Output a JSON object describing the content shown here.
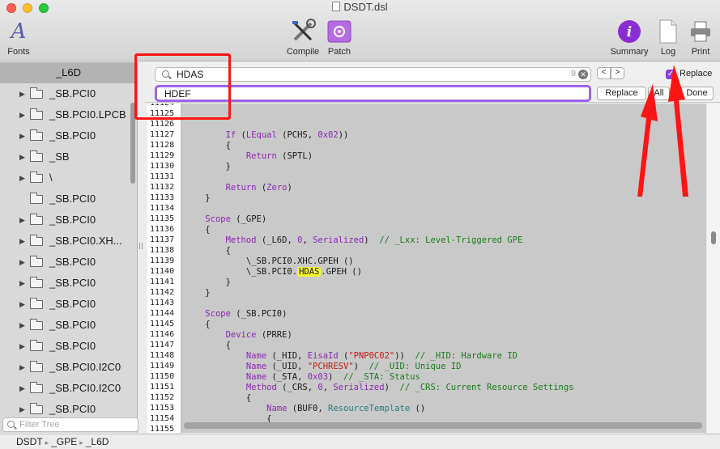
{
  "window": {
    "title": "DSDT.dsl"
  },
  "toolbar": {
    "fonts_label": "Fonts",
    "compile_label": "Compile",
    "patch_label": "Patch",
    "summary_label": "Summary",
    "log_label": "Log",
    "print_label": "Print"
  },
  "sidebar": {
    "header": "_L6D",
    "items": [
      {
        "label": "_SB.PCI0",
        "expandable": true
      },
      {
        "label": "_SB.PCI0.LPCB",
        "expandable": true
      },
      {
        "label": "_SB.PCI0",
        "expandable": true
      },
      {
        "label": "_SB",
        "expandable": true
      },
      {
        "label": "\\",
        "expandable": true
      },
      {
        "label": "_SB.PCI0",
        "expandable": false
      },
      {
        "label": "_SB.PCI0",
        "expandable": true
      },
      {
        "label": "_SB.PCI0.XH...",
        "expandable": true
      },
      {
        "label": "_SB.PCI0",
        "expandable": true
      },
      {
        "label": "_SB.PCI0",
        "expandable": true
      },
      {
        "label": "_SB.PCI0",
        "expandable": true
      },
      {
        "label": "_SB.PCI0",
        "expandable": true
      },
      {
        "label": "_SB.PCI0",
        "expandable": true
      },
      {
        "label": "_SB.PCI0.I2C0",
        "expandable": true
      },
      {
        "label": "_SB.PCI0.I2C0",
        "expandable": true
      },
      {
        "label": "_SB.PCI0",
        "expandable": true
      }
    ],
    "filter_placeholder": "Filter Tree"
  },
  "find": {
    "search_value": "HDAS",
    "match_count": "9",
    "replace_value": "HDEF",
    "prev_label": "<",
    "next_label": ">",
    "replace_checkbox_label": "Replace",
    "replace_checked": true,
    "replace_button": "Replace",
    "all_button": "All",
    "done_button": "Done"
  },
  "editor": {
    "line_numbers": [
      "11124",
      "11125",
      "11126",
      "11127",
      "11128",
      "11129",
      "11130",
      "11131",
      "11132",
      "11133",
      "11134",
      "11135",
      "11136",
      "11137",
      "11138",
      "11139",
      "11140",
      "11141",
      "11142",
      "11143",
      "11144",
      "11145",
      "11146",
      "11147",
      "11148",
      "11149",
      "11150",
      "11151",
      "11152",
      "11153",
      "11154",
      "11155"
    ],
    "highlighted_match": "HDAS"
  },
  "statusbar": {
    "crumbs": [
      "DSDT",
      "_GPE",
      "_L6D"
    ]
  },
  "colors": {
    "accent": "#8b3fd6",
    "annotation": "#ff1414",
    "match_highlight": "#f3f531"
  }
}
